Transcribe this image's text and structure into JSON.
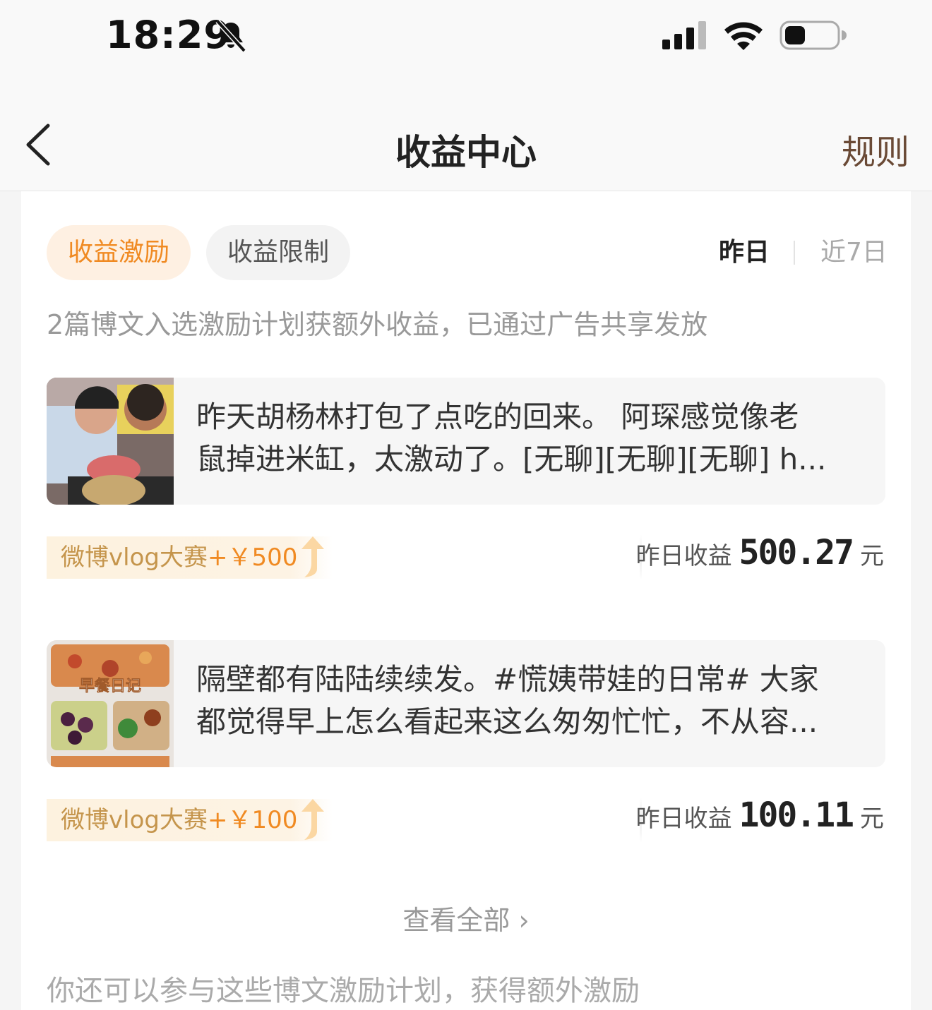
{
  "status_bar": {
    "time": "18:29",
    "icons": [
      "bell-off-icon",
      "signal-icon",
      "wifi-icon",
      "battery-icon"
    ]
  },
  "nav": {
    "title": "收益中心",
    "rules_label": "规则",
    "back_icon": "chevron-left-icon"
  },
  "tabs": [
    {
      "label": "收益激励",
      "active": true
    },
    {
      "label": "收益限制",
      "active": false
    }
  ],
  "period": {
    "yesterday": "昨日",
    "last7": "近7日",
    "selected": "昨日"
  },
  "intro": "2篇博文入选激励计划获额外收益，已通过广告共享发放",
  "posts": [
    {
      "line1": "昨天胡杨林打包了点吃的回来。 阿琛感觉像老",
      "line2": "鼠掉进米缸，太激动了。[无聊][无聊][无聊] h...",
      "badge_name": "微博vlog大赛",
      "badge_amount": "+￥500",
      "earn_label": "昨日收益",
      "earn_value": "500.27",
      "earn_unit": "元"
    },
    {
      "line1": "隔壁都有陆陆续续发。#慌姨带娃的日常# 大家",
      "line2": "都觉得早上怎么看起来这么匆匆忙忙，不从容...",
      "thumb_caption": "早餐日记",
      "badge_name": "微博vlog大赛",
      "badge_amount": "+￥100",
      "earn_label": "昨日收益",
      "earn_value": "100.11",
      "earn_unit": "元"
    }
  ],
  "view_all": "查看全部 ›",
  "more_text": "你还可以参与这些博文激励计划，获得额外激励",
  "colors": {
    "accent": "#f08a22",
    "rules": "#6a4a36",
    "badge_bg": "#fdf2df"
  }
}
